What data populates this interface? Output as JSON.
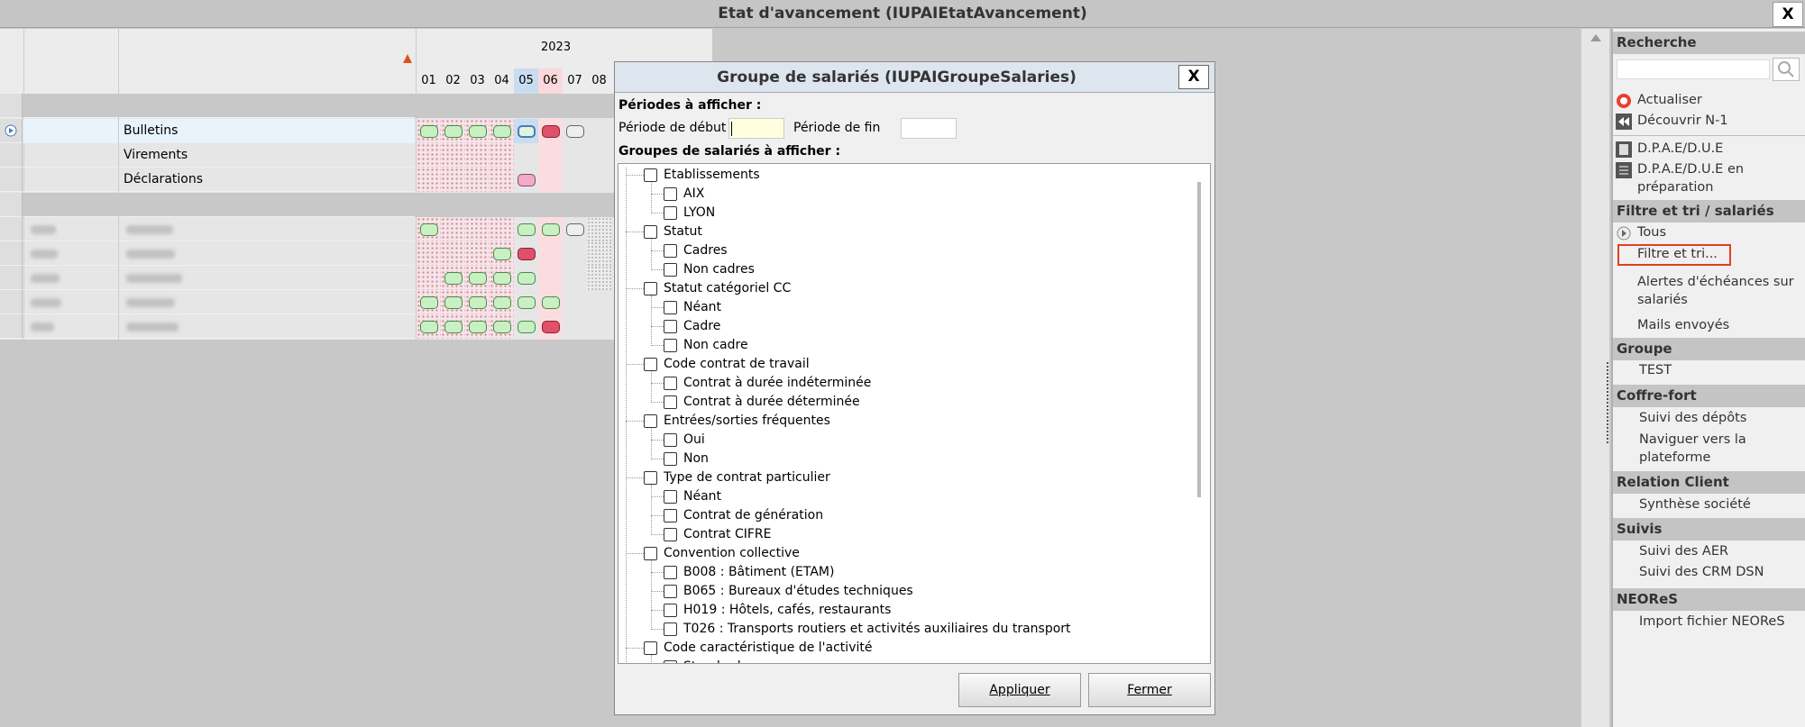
{
  "window": {
    "title": "Etat d'avancement (IUPAIEtatAvancement)",
    "close": "X"
  },
  "grid": {
    "year": "2023",
    "months": [
      "01",
      "02",
      "03",
      "04",
      "05",
      "06",
      "07",
      "08"
    ],
    "rows": [
      {
        "label": "Bulletins"
      },
      {
        "label": "Virements"
      },
      {
        "label": "Déclarations"
      }
    ]
  },
  "dialog": {
    "title": "Groupe de salariés (IUPAIGroupeSalaries)",
    "close": "X",
    "periods_heading": "Périodes à afficher :",
    "start_label": "Période de début",
    "end_label": "Période de fin",
    "groups_heading": "Groupes de salariés à afficher :",
    "tree": [
      {
        "label": "Etablissements",
        "children": [
          "AIX",
          "LYON"
        ]
      },
      {
        "label": "Statut",
        "children": [
          "Cadres",
          "Non cadres"
        ]
      },
      {
        "label": "Statut catégoriel CC",
        "children": [
          "Néant",
          "Cadre",
          "Non cadre"
        ]
      },
      {
        "label": "Code contrat de travail",
        "children": [
          "Contrat à durée indéterminée",
          "Contrat à durée déterminée"
        ]
      },
      {
        "label": "Entrées/sorties fréquentes",
        "children": [
          "Oui",
          "Non"
        ]
      },
      {
        "label": "Type de contrat particulier",
        "children": [
          "Néant",
          "Contrat de génération",
          "Contrat CIFRE"
        ]
      },
      {
        "label": "Convention collective",
        "children": [
          "B008 : Bâtiment (ETAM)",
          "B065 : Bureaux d'études techniques",
          "H019 : Hôtels, cafés, restaurants",
          "T026 : Transports routiers et activités auxiliaires du transport"
        ]
      },
      {
        "label": "Code caractéristique de l'activité",
        "children": [
          "Standard"
        ]
      }
    ],
    "apply": "Appliquer",
    "close_button": "Fermer"
  },
  "panel": {
    "search": "Recherche",
    "refresh": "Actualiser",
    "discover": "Découvrir N-1",
    "dpae": "D.P.A.E/D.U.E",
    "dpae_prep_1": "D.P.A.E/D.U.E en",
    "dpae_prep_2": "préparation",
    "filter_section": "Filtre et tri / salariés",
    "all": "Tous",
    "filter": "Filtre et tri...",
    "alerts_1": "Alertes d'échéances sur",
    "alerts_2": "salariés",
    "mails": "Mails envoyés",
    "group_section": "Groupe",
    "group_value": "TEST",
    "vault_section": "Coffre-fort",
    "deposits": "Suivi des dépôts",
    "navigate_1": "Naviguer vers la",
    "navigate_2": "plateforme",
    "client_section": "Relation Client",
    "synthesis": "Synthèse société",
    "followup_section": "Suivis",
    "aer": "Suivi des AER",
    "crm": "Suivi des CRM DSN",
    "neores_section": "NEOReS",
    "import": "Import fichier NEOReS"
  },
  "colors": {
    "accent_outline": "#e04020",
    "pill_green": "#c9f0c3",
    "pill_red": "#e0506a"
  }
}
